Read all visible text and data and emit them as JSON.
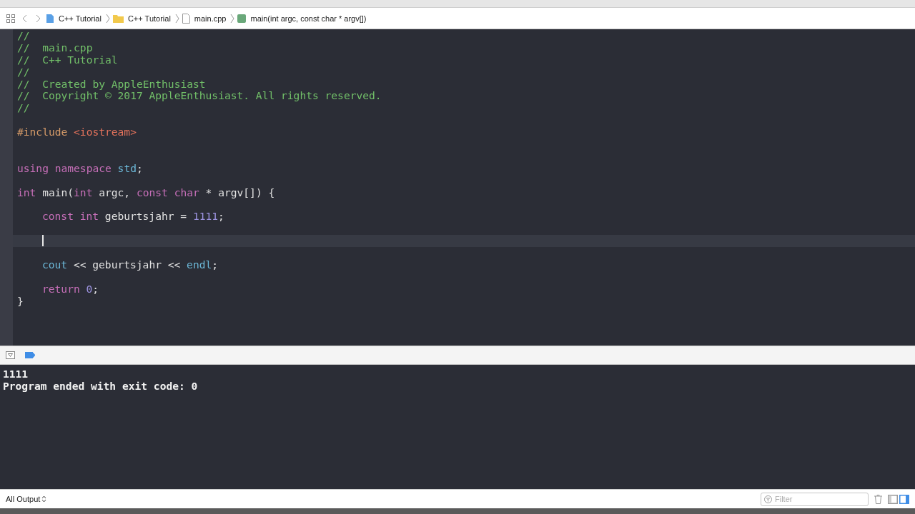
{
  "jump_bar": {
    "breadcrumbs": [
      {
        "label": "C++ Tutorial",
        "kind": "project"
      },
      {
        "label": "C++ Tutorial",
        "kind": "folder"
      },
      {
        "label": "main.cpp",
        "kind": "file"
      },
      {
        "label": "main(int argc, const char * argv[])",
        "kind": "function"
      }
    ]
  },
  "editor": {
    "lines": [
      {
        "kind": "code",
        "tokens": [
          {
            "text": "//",
            "kind": "comment"
          }
        ]
      },
      {
        "kind": "code",
        "tokens": [
          {
            "text": "//  main.cpp",
            "kind": "comment"
          }
        ]
      },
      {
        "kind": "code",
        "tokens": [
          {
            "text": "//  C++ Tutorial",
            "kind": "comment"
          }
        ]
      },
      {
        "kind": "code",
        "tokens": [
          {
            "text": "//",
            "kind": "comment"
          }
        ]
      },
      {
        "kind": "code",
        "tokens": [
          {
            "text": "//  Created by AppleEnthusiast",
            "kind": "comment"
          }
        ]
      },
      {
        "kind": "code",
        "tokens": [
          {
            "text": "//  Copyright © 2017 AppleEnthusiast. All rights reserved.",
            "kind": "comment"
          }
        ]
      },
      {
        "kind": "code",
        "tokens": [
          {
            "text": "//",
            "kind": "comment"
          }
        ]
      },
      {
        "kind": "blank"
      },
      {
        "kind": "code",
        "tokens": [
          {
            "text": "#include ",
            "kind": "preprocessor"
          },
          {
            "text": "<iostream>",
            "kind": "string"
          }
        ]
      },
      {
        "kind": "blank"
      },
      {
        "kind": "blank"
      },
      {
        "kind": "code",
        "tokens": [
          {
            "text": "using namespace ",
            "kind": "keyword"
          },
          {
            "text": "std",
            "kind": "library"
          },
          {
            "text": ";",
            "kind": "plain"
          }
        ]
      },
      {
        "kind": "blank"
      },
      {
        "kind": "code",
        "tokens": [
          {
            "text": "int",
            "kind": "keyword"
          },
          {
            "text": " main(",
            "kind": "plain"
          },
          {
            "text": "int",
            "kind": "keyword"
          },
          {
            "text": " argc, ",
            "kind": "plain"
          },
          {
            "text": "const char",
            "kind": "keyword"
          },
          {
            "text": " * argv[]) {",
            "kind": "plain"
          }
        ],
        "children": [
          {
            "kind": "blank"
          },
          {
            "kind": "code",
            "tokens": [
              {
                "text": "const int",
                "kind": "keyword"
              },
              {
                "text": " geburtsjahr = ",
                "kind": "plain"
              },
              {
                "text": "1111",
                "kind": "number"
              },
              {
                "text": ";",
                "kind": "plain"
              }
            ]
          },
          {
            "kind": "blank"
          },
          {
            "kind": "current"
          },
          {
            "kind": "blank"
          },
          {
            "kind": "code",
            "tokens": [
              {
                "text": "cout",
                "kind": "library"
              },
              {
                "text": " << geburtsjahr << ",
                "kind": "plain"
              },
              {
                "text": "endl",
                "kind": "library"
              },
              {
                "text": ";",
                "kind": "plain"
              }
            ]
          },
          {
            "kind": "blank"
          },
          {
            "kind": "code",
            "tokens": [
              {
                "text": "return ",
                "kind": "keyword"
              },
              {
                "text": "0",
                "kind": "number"
              },
              {
                "text": ";",
                "kind": "plain"
              }
            ]
          }
        ]
      },
      {
        "kind": "code",
        "tokens": [
          {
            "text": "}",
            "kind": "plain"
          }
        ]
      }
    ]
  },
  "debug_bar": {
    "breakpoints_active": true
  },
  "console": {
    "lines": [
      "1111",
      "Program ended with exit code: 0"
    ]
  },
  "bottom_bar": {
    "output_menu": "All Output",
    "filter": {
      "placeholder": "Filter"
    },
    "panes": [
      {
        "selected": false
      },
      {
        "selected": true
      }
    ]
  }
}
